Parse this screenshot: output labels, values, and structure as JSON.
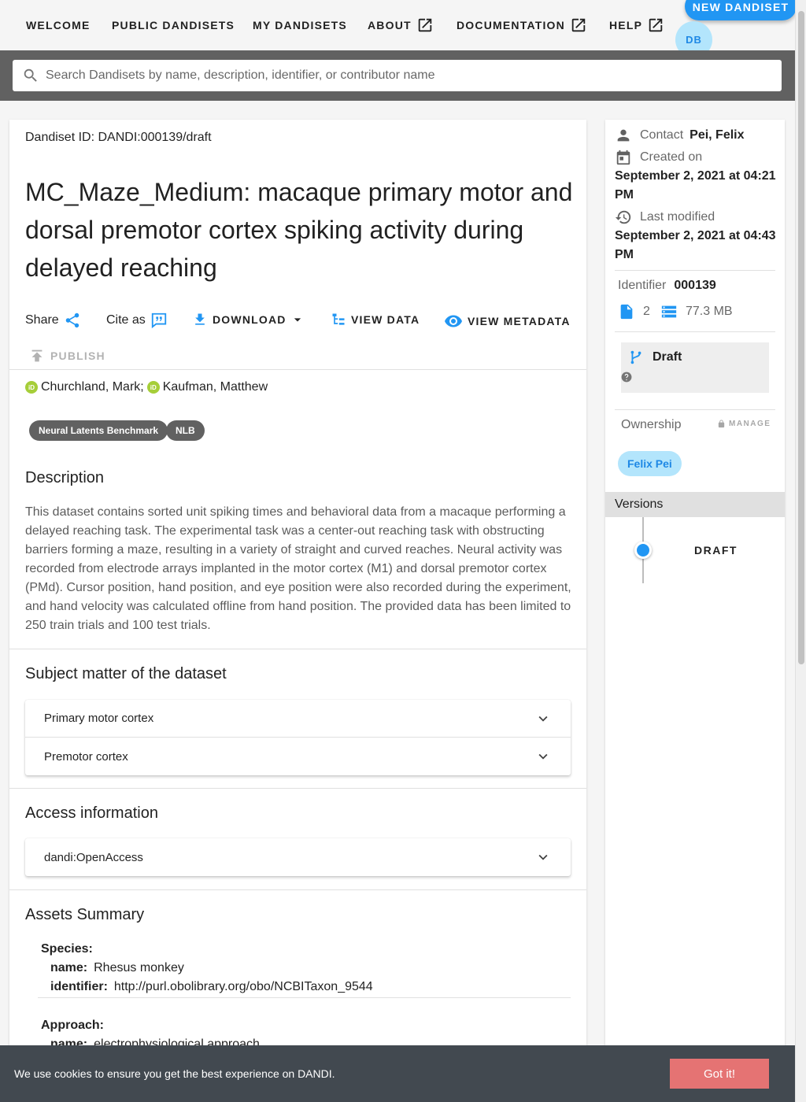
{
  "nav": {
    "items": [
      {
        "label": "Welcome"
      },
      {
        "label": "Public Dandisets"
      },
      {
        "label": "My Dandisets"
      },
      {
        "label": "About",
        "external": true
      },
      {
        "label": "Documentation",
        "external": true
      },
      {
        "label": "Help",
        "external": true
      }
    ],
    "new_dandiset_label": "New Dandiset",
    "avatar_initials": "DB"
  },
  "search": {
    "placeholder": "Search Dandisets by name, description, identifier, or contributor name"
  },
  "dandiset": {
    "id_line": "Dandiset ID: DANDI:000139/draft",
    "title": "MC_Maze_Medium: macaque primary motor and dorsal premotor cortex spiking activity during delayed reaching",
    "actions": {
      "share": "Share",
      "cite": "Cite as",
      "download": "Download",
      "view_data": "View Data",
      "view_metadata": "View Metadata",
      "publish": "Publish"
    },
    "contributors": [
      "Churchland, Mark;",
      "Kaufman, Matthew"
    ],
    "keywords": [
      "Neural Latents Benchmark",
      "NLB"
    ],
    "description_heading": "Description",
    "description": "This dataset contains sorted unit spiking times and behavioral data from a macaque performing a delayed reaching task. The experimental task was a center-out reaching task with obstructing barriers forming a maze, resulting in a variety of straight and curved reaches. Neural activity was recorded from electrode arrays implanted in the motor cortex (M1) and dorsal premotor cortex (PMd). Cursor position, hand position, and eye position were also recorded during the experiment, and hand velocity was calculated offline from hand position. The provided data has been limited to 250 train trials and 100 test trials.",
    "subject_heading": "Subject matter of the dataset",
    "subjects": [
      "Primary motor cortex",
      "Premotor cortex"
    ],
    "access_heading": "Access information",
    "access": [
      "dandi:OpenAccess"
    ],
    "assets_heading": "Assets Summary",
    "assets": {
      "species_label": "Species:",
      "species_name_key": "name:",
      "species_name": "Rhesus monkey",
      "species_identifier_key": "identifier:",
      "species_identifier": "http://purl.obolibrary.org/obo/NCBITaxon_9544",
      "approach_label": "Approach:",
      "approach_name_key": "name:",
      "approach_name": "electrophysiological approach"
    }
  },
  "sidebar": {
    "contact_label": "Contact",
    "contact_name": "Pei, Felix",
    "created_label": "Created on",
    "created_date": "September 2, 2021 at 04:21 PM",
    "modified_label": "Last modified",
    "modified_date": "September 2, 2021 at 04:43 PM",
    "identifier_label": "Identifier",
    "identifier_value": "000139",
    "file_count": "2",
    "size": "77.3 MB",
    "status": "Draft",
    "ownership_label": "Ownership",
    "manage_label": "Manage",
    "owner": "Felix Pei",
    "versions_label": "Versions",
    "version_item": "DRAFT"
  },
  "cookie": {
    "message": "We use cookies to ensure you get the best experience on DANDI.",
    "button": "Got it!"
  },
  "colors": {
    "primary": "#2196f3",
    "chip_dark": "#616161",
    "avatar_bg": "#b3e5fc",
    "cookie_bg": "#424950",
    "cookie_button": "#e57373",
    "orcid": "#a6ce39"
  }
}
